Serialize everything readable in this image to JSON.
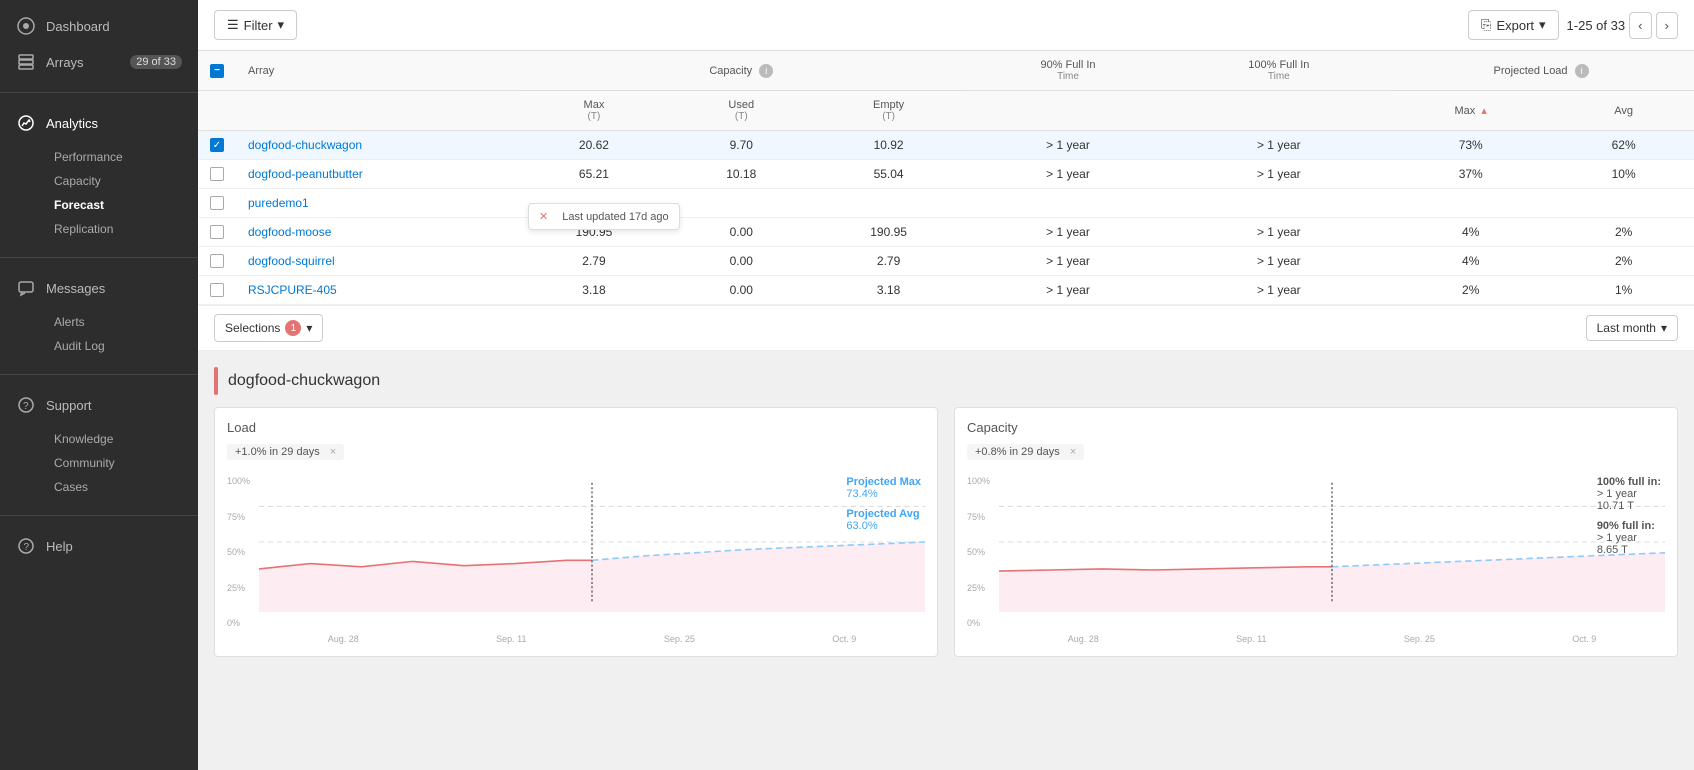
{
  "sidebar": {
    "dashboard_label": "Dashboard",
    "arrays_label": "Arrays",
    "arrays_badge": "29 of 33",
    "analytics_label": "Analytics",
    "performance_label": "Performance",
    "capacity_label": "Capacity",
    "forecast_label": "Forecast",
    "replication_label": "Replication",
    "messages_label": "Messages",
    "alerts_label": "Alerts",
    "audit_log_label": "Audit Log",
    "support_label": "Support",
    "knowledge_label": "Knowledge",
    "community_label": "Community",
    "cases_label": "Cases",
    "help_label": "Help"
  },
  "toolbar": {
    "filter_label": "Filter",
    "export_label": "Export",
    "pagination": "1-25 of 33"
  },
  "table": {
    "headers": {
      "array": "Array",
      "capacity": "Capacity",
      "capacity_info": "i",
      "max": "Max",
      "max_unit": "(T)",
      "used": "Used",
      "used_unit": "(T)",
      "empty": "Empty",
      "empty_unit": "(T)",
      "full90": "90% Full In",
      "full90_sub": "Time",
      "full100": "100% Full In",
      "full100_sub": "Time",
      "projected": "Projected Load",
      "projected_info": "i",
      "proj_max": "Max",
      "proj_avg": "Avg"
    },
    "rows": [
      {
        "name": "dogfood-chuckwagon",
        "max": "20.62",
        "used": "9.70",
        "empty": "10.92",
        "full90": "> 1 year",
        "full100": "> 1 year",
        "proj_max": "73%",
        "proj_avg": "62%",
        "selected": true
      },
      {
        "name": "dogfood-peanutbutter",
        "max": "65.21",
        "used": "10.18",
        "empty": "55.04",
        "full90": "> 1 year",
        "full100": "> 1 year",
        "proj_max": "37%",
        "proj_avg": "10%",
        "selected": false
      },
      {
        "name": "puredemo1",
        "max": "",
        "used": "",
        "empty": "",
        "full90": "",
        "full100": "",
        "proj_max": "",
        "proj_avg": "",
        "selected": false,
        "tooltip": "Last updated 17d ago"
      },
      {
        "name": "dogfood-moose",
        "max": "190.95",
        "used": "0.00",
        "empty": "190.95",
        "full90": "> 1 year",
        "full100": "> 1 year",
        "proj_max": "4%",
        "proj_avg": "2%",
        "selected": false
      },
      {
        "name": "dogfood-squirrel",
        "max": "2.79",
        "used": "0.00",
        "empty": "2.79",
        "full90": "> 1 year",
        "full100": "> 1 year",
        "proj_max": "4%",
        "proj_avg": "2%",
        "selected": false
      },
      {
        "name": "RSJCPURE-405",
        "max": "3.18",
        "used": "0.00",
        "empty": "3.18",
        "full90": "> 1 year",
        "full100": "> 1 year",
        "proj_max": "2%",
        "proj_avg": "1%",
        "selected": false
      }
    ]
  },
  "selections": {
    "label": "Selections",
    "count": "1",
    "period": "Last month"
  },
  "detail": {
    "array_name": "dogfood-chuckwagon",
    "load_title": "Load",
    "capacity_title": "Capacity",
    "load_delta": "+1.0% in 29 days",
    "capacity_delta": "+0.8% in 29 days",
    "projected_max_label": "Projected Max",
    "projected_max_value": "73.4%",
    "projected_avg_label": "Projected Avg",
    "projected_avg_value": "63.0%",
    "full100_label": "100% full in:",
    "full100_time": "> 1 year",
    "full100_value": "10.71 T",
    "full90_label": "90% full in:",
    "full90_time": "> 1 year",
    "full90_value": "8.65 T",
    "x_labels_load": [
      "Aug. 28",
      "Sep. 11",
      "Sep. 25",
      "Oct. 9"
    ],
    "x_labels_cap": [
      "Aug. 28",
      "Sep. 11",
      "Sep. 25",
      "Oct. 9"
    ],
    "y_labels": [
      "100%",
      "75%",
      "50%",
      "25%",
      "0%"
    ]
  }
}
